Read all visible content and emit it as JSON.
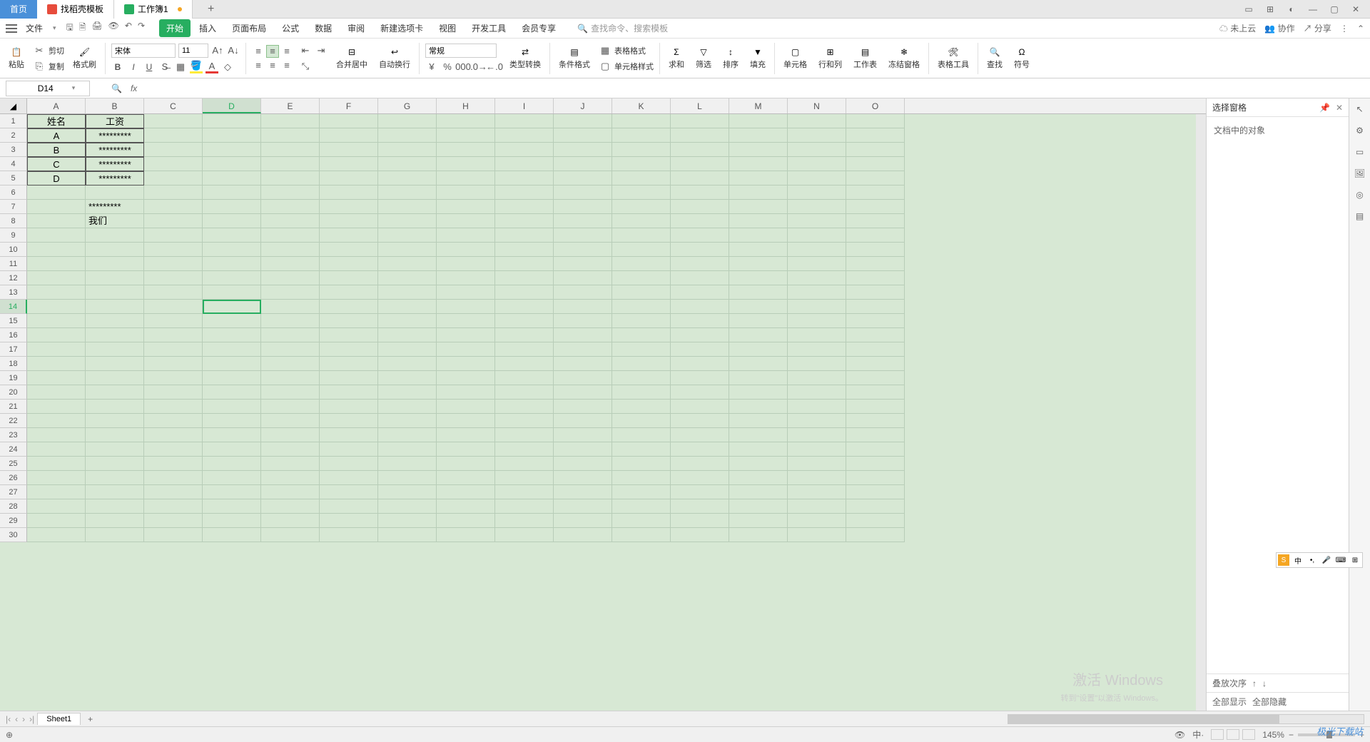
{
  "tabs": {
    "home": "首页",
    "templates": "找稻壳模板",
    "workbook": "工作簿1"
  },
  "menu": {
    "file": "文件",
    "tabs": [
      "开始",
      "插入",
      "页面布局",
      "公式",
      "数据",
      "审阅",
      "新建选项卡",
      "视图",
      "开发工具",
      "会员专享"
    ],
    "active_index": 0,
    "search_placeholder": "查找命令、搜索模板",
    "cloud": "未上云",
    "coop": "协作",
    "share": "分享"
  },
  "ribbon": {
    "paste": "粘贴",
    "cut": "剪切",
    "copy": "复制",
    "format_painter": "格式刷",
    "font_name": "宋体",
    "font_size": "11",
    "merge": "合并居中",
    "wrap": "自动换行",
    "number_format": "常规",
    "type_convert": "类型转换",
    "cond_format": "条件格式",
    "table_style": "表格格式",
    "cell_style": "单元格样式",
    "sum": "求和",
    "filter": "筛选",
    "sort": "排序",
    "fill": "填充",
    "cell": "单元格",
    "rowcol": "行和列",
    "worksheet": "工作表",
    "freeze": "冻结窗格",
    "table_tools": "表格工具",
    "find": "查找",
    "symbol": "符号"
  },
  "formula_bar": {
    "name_box": "D14"
  },
  "columns": [
    "A",
    "B",
    "C",
    "D",
    "E",
    "F",
    "G",
    "H",
    "I",
    "J",
    "K",
    "L",
    "M",
    "N",
    "O"
  ],
  "active_col_index": 3,
  "active_row": 14,
  "data_cells": {
    "header": {
      "A": "姓名",
      "B": "工资"
    },
    "rows": [
      {
        "A": "A",
        "B": "*********"
      },
      {
        "A": "B",
        "B": "*********"
      },
      {
        "A": "C",
        "B": "*********"
      },
      {
        "A": "D",
        "B": "*********"
      }
    ],
    "B7": "*********",
    "B8": "我们"
  },
  "side_pane": {
    "title": "选择窗格",
    "objects_label": "文档中的对象",
    "stack_order": "叠放次序",
    "show_all": "全部显示",
    "hide_all": "全部隐藏"
  },
  "sheet_tabs": {
    "sheet1": "Sheet1"
  },
  "status": {
    "zoom": "145%"
  },
  "watermark": {
    "line1": "激活 Windows",
    "line2": "转到\"设置\"以激活 Windows。"
  },
  "logo": "极光下载站"
}
